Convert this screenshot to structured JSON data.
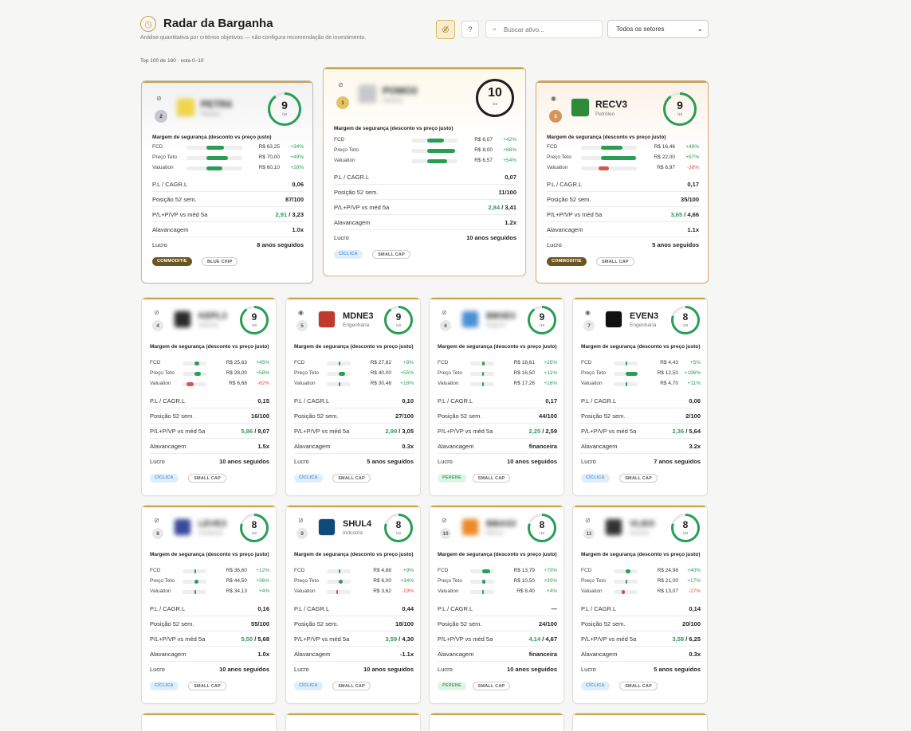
{
  "header": {
    "title": "Radar da Barganha",
    "subtitle": "Análise quantitativa por critérios objetivos — não configura recomendação de investimento.",
    "search_placeholder": "Buscar ativo...",
    "sector_select": "Todos os setores",
    "count": "Top 100 de 180 · nota 0–10"
  },
  "labels": {
    "margin": "Margem de segurança (desconto vs preço justo)",
    "fcd": "FCD",
    "teto": "Preço Teto",
    "val": "Valuation",
    "pl": "P.L / CAGR.L",
    "pos52": "Posição 52 sem.",
    "plvp": "P/L+P/VP vs méd 5a",
    "alav": "Alavancagem",
    "lucro": "Lucro",
    "den": "/10"
  },
  "colors": {
    "gold": "#c9a24a",
    "green": "#2a9d55",
    "red": "#d9534f"
  },
  "cards": [
    {
      "rank": "2",
      "ticker": "PETR4",
      "sector": "Petróleo",
      "score": "9",
      "blurred": true,
      "eye": "hidden",
      "fcd": {
        "v": "R$ 63,25",
        "p": "+34%",
        "f": 0.34
      },
      "teto": {
        "v": "R$ 70,00",
        "p": "+49%",
        "f": 0.49
      },
      "val": {
        "v": "R$ 60,10",
        "p": "+28%",
        "f": 0.28
      },
      "pl": "0,06",
      "pos52": "87/100",
      "plvp_g": "2,91",
      "plvp_r": " / 3,23",
      "alav": "1.0x",
      "lucro": "8 anos seguidos",
      "tags": [
        "COMMODITIE",
        "BLUE CHIP"
      ]
    },
    {
      "rank": "1",
      "ticker": "POMO3",
      "sector": "Indústria",
      "score": "10",
      "blurred": true,
      "eye": "hidden",
      "fcd": {
        "v": "R$ 6,07",
        "p": "+42%",
        "f": 0.42
      },
      "teto": {
        "v": "R$ 8,00",
        "p": "+88%",
        "f": 0.88
      },
      "val": {
        "v": "R$ 6,57",
        "p": "+54%",
        "f": 0.54
      },
      "pl": "0,07",
      "pos52": "11/100",
      "plvp_g": "2,84",
      "plvp_r": " / 3,41",
      "alav": "1.2x",
      "lucro": "10 anos seguidos",
      "tags": [
        "CÍCLICA",
        "SMALL CAP"
      ]
    },
    {
      "rank": "3",
      "ticker": "RECV3",
      "sector": "Petróleo",
      "score": "9",
      "blurred": false,
      "eye": "visible",
      "fcd": {
        "v": "R$ 16,46",
        "p": "+48%",
        "f": 0.48
      },
      "teto": {
        "v": "R$ 22,00",
        "p": "+97%",
        "f": 0.97
      },
      "val": {
        "v": "R$ 6,97",
        "p": "-38%",
        "f": -0.38
      },
      "pl": "0,17",
      "pos52": "35/100",
      "plvp_g": "3,65",
      "plvp_r": " / 4,66",
      "alav": "1.1x",
      "lucro": "5 anos seguidos",
      "tags": [
        "COMMODITIE",
        "SMALL CAP"
      ]
    },
    {
      "rank": "4",
      "ticker": "KEPL3",
      "sector": "Indústria",
      "score": "9",
      "blurred": true,
      "eye": "hidden",
      "fcd": {
        "v": "R$ 25,63",
        "p": "+45%",
        "f": 0.45
      },
      "teto": {
        "v": "R$ 28,00",
        "p": "+58%",
        "f": 0.58
      },
      "val": {
        "v": "R$ 6,68",
        "p": "-62%",
        "f": -0.62
      },
      "pl": "0,15",
      "pos52": "16/100",
      "plvp_g": "5,86",
      "plvp_r": " / 8,07",
      "alav": "1.5x",
      "lucro": "10 anos seguidos",
      "tags": [
        "CÍCLICA",
        "SMALL CAP"
      ]
    },
    {
      "rank": "5",
      "ticker": "MDNE3",
      "sector": "Engenharia",
      "score": "9",
      "blurred": false,
      "eye": "visible",
      "fcd": {
        "v": "R$ 27,82",
        "p": "+8%",
        "f": 0.08
      },
      "teto": {
        "v": "R$ 40,00",
        "p": "+55%",
        "f": 0.55
      },
      "val": {
        "v": "R$ 30,48",
        "p": "+18%",
        "f": 0.18
      },
      "pl": "0,10",
      "pos52": "27/100",
      "plvp_g": "2,99",
      "plvp_r": " / 3,05",
      "alav": "0.3x",
      "lucro": "5 anos seguidos",
      "tags": [
        "CÍCLICA",
        "SMALL CAP"
      ]
    },
    {
      "rank": "6",
      "ticker": "BBSE3",
      "sector": "Seguros",
      "score": "9",
      "blurred": true,
      "eye": "hidden",
      "fcd": {
        "v": "R$ 18,61",
        "p": "+25%",
        "f": 0.25
      },
      "teto": {
        "v": "R$ 16,50",
        "p": "+11%",
        "f": 0.11
      },
      "val": {
        "v": "R$ 17,26",
        "p": "+16%",
        "f": 0.16
      },
      "pl": "0,17",
      "pos52": "44/100",
      "plvp_g": "2,25",
      "plvp_r": " / 2,59",
      "alav": "financeira",
      "lucro": "10 anos seguidos",
      "tags": [
        "PERENE",
        "SMALL CAP"
      ]
    },
    {
      "rank": "7",
      "ticker": "EVEN3",
      "sector": "Engenharia",
      "score": "8",
      "blurred": false,
      "eye": "visible",
      "fcd": {
        "v": "R$ 4,43",
        "p": "+5%",
        "f": 0.05
      },
      "teto": {
        "v": "R$ 12,50",
        "p": "+196%",
        "f": 1.0
      },
      "val": {
        "v": "R$ 4,70",
        "p": "+11%",
        "f": 0.11
      },
      "pl": "0,06",
      "pos52": "2/100",
      "plvp_g": "2,36",
      "plvp_r": " / 5,64",
      "alav": "3.2x",
      "lucro": "7 anos seguidos",
      "tags": [
        "CÍCLICA",
        "SMALL CAP"
      ]
    },
    {
      "rank": "8",
      "ticker": "LEVE3",
      "sector": "Autopeças",
      "score": "8",
      "blurred": true,
      "eye": "hidden",
      "fcd": {
        "v": "R$ 36,60",
        "p": "+12%",
        "f": 0.12
      },
      "teto": {
        "v": "R$ 44,50",
        "p": "+36%",
        "f": 0.36
      },
      "val": {
        "v": "R$ 34,13",
        "p": "+4%",
        "f": 0.04
      },
      "pl": "0,16",
      "pos52": "55/100",
      "plvp_g": "5,50",
      "plvp_r": " / 5,68",
      "alav": "1.0x",
      "lucro": "10 anos seguidos",
      "tags": [
        "CÍCLICA",
        "SMALL CAP"
      ]
    },
    {
      "rank": "9",
      "ticker": "SHUL4",
      "sector": "Indústria",
      "score": "8",
      "blurred": false,
      "eye": "hidden",
      "fcd": {
        "v": "R$ 4,88",
        "p": "+9%",
        "f": 0.09
      },
      "teto": {
        "v": "R$ 6,00",
        "p": "+34%",
        "f": 0.34
      },
      "val": {
        "v": "R$ 3,62",
        "p": "-19%",
        "f": -0.19
      },
      "pl": "0,44",
      "pos52": "18/100",
      "plvp_g": "3,59",
      "plvp_r": " / 4,30",
      "alav": "-1.1x",
      "lucro": "10 anos seguidos",
      "tags": [
        "CÍCLICA",
        "SMALL CAP"
      ]
    },
    {
      "rank": "10",
      "ticker": "BBAS3",
      "sector": "Bancos",
      "score": "8",
      "blurred": true,
      "eye": "hidden",
      "fcd": {
        "v": "R$ 13,79",
        "p": "+70%",
        "f": 0.7
      },
      "teto": {
        "v": "R$ 10,50",
        "p": "+30%",
        "f": 0.3
      },
      "val": {
        "v": "R$ 8,40",
        "p": "+4%",
        "f": 0.04
      },
      "pl": "—",
      "pos52": "24/100",
      "plvp_g": "4,14",
      "plvp_r": " / 4,67",
      "alav": "financeira",
      "lucro": "10 anos seguidos",
      "tags": [
        "PERENE",
        "SMALL CAP"
      ]
    },
    {
      "rank": "11",
      "ticker": "VLID3",
      "sector": "Serviços",
      "score": "8",
      "blurred": true,
      "eye": "hidden",
      "fcd": {
        "v": "R$ 24,98",
        "p": "+40%",
        "f": 0.4
      },
      "teto": {
        "v": "R$ 21,00",
        "p": "+17%",
        "f": 0.17
      },
      "val": {
        "v": "R$ 13,07",
        "p": "-27%",
        "f": -0.27
      },
      "pl": "0,14",
      "pos52": "20/100",
      "plvp_g": "3,58",
      "plvp_r": " / 6,25",
      "alav": "0.3x",
      "lucro": "5 anos seguidos",
      "tags": [
        "CÍCLICA",
        "SMALL CAP"
      ]
    }
  ]
}
